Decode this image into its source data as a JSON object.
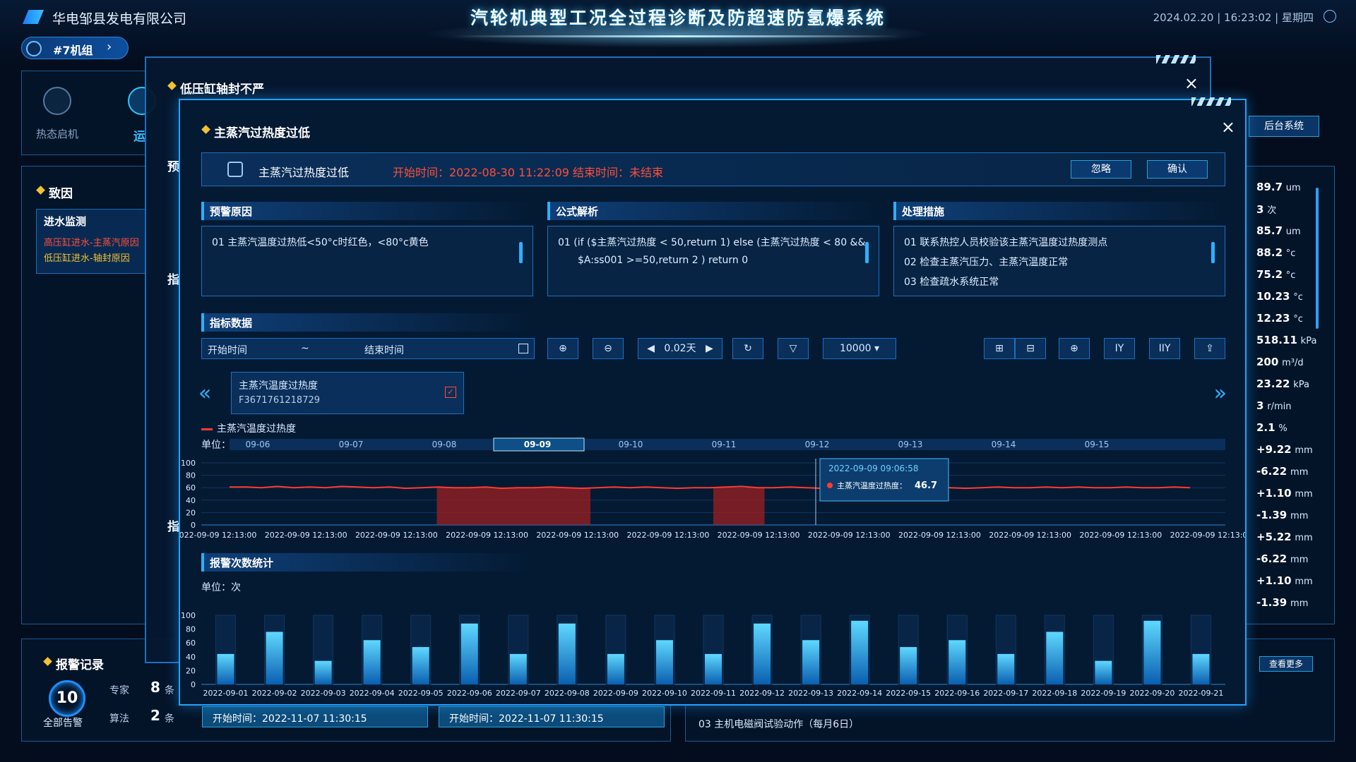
{
  "header": {
    "company": "华电邹县发电有限公司",
    "title": "汽轮机典型工况全过程诊断及防超速防氢爆系统",
    "datetime": "2024.02.20 | 16:23:02 | 星期四",
    "unit": "#7机组"
  },
  "status_steps": {
    "hot_start": "热态启机",
    "run": "运"
  },
  "cause_panel": {
    "title": "致因",
    "section": "进水监测",
    "items": [
      "高压缸进水-主蒸汽原因",
      "低压缸进水-轴封原因"
    ]
  },
  "alarm_records": {
    "title": "报警记录",
    "total": "10",
    "total_label": "全部告警",
    "expert_label": "专家",
    "expert_count": "8",
    "expert_unit": "条",
    "algo_label": "算法",
    "algo_count": "2",
    "algo_unit": "条",
    "start_1": "开始时间：2022-11-07 11:30:15",
    "start_2": "开始时间：2022-11-07 11:30:15",
    "task_03": "03   主机电磁阀试验动作（每月6日）",
    "see_more": "查看更多"
  },
  "right_values": [
    {
      "value": "89.7",
      "unit": "um"
    },
    {
      "value": "3",
      "unit": "次"
    },
    {
      "value": "85.7",
      "unit": "um"
    },
    {
      "value": "88.2",
      "unit": "°c"
    },
    {
      "value": "75.2",
      "unit": "°c"
    },
    {
      "value": "10.23",
      "unit": "°c"
    },
    {
      "value": "12.23",
      "unit": "°c"
    },
    {
      "value": "518.11",
      "unit": "kPa"
    },
    {
      "value": "200",
      "unit": "m³/d"
    },
    {
      "value": "23.22",
      "unit": "kPa"
    },
    {
      "value": "3",
      "unit": "r/min"
    },
    {
      "value": "2.1",
      "unit": "%"
    },
    {
      "value": "+9.22",
      "unit": "mm"
    },
    {
      "value": "-6.22",
      "unit": "mm"
    },
    {
      "value": "+1.10",
      "unit": "mm"
    },
    {
      "value": "-1.39",
      "unit": "mm"
    },
    {
      "value": "+5.22",
      "unit": "mm"
    },
    {
      "value": "-6.22",
      "unit": "mm"
    },
    {
      "value": "+1.10",
      "unit": "mm"
    },
    {
      "value": "-1.39",
      "unit": "mm"
    }
  ],
  "backend_button": "后台系统",
  "modal_outer": {
    "title": "低压缸轴封不严",
    "close": "×",
    "side_1": "预",
    "side_2": "指",
    "side_3": "指"
  },
  "modal": {
    "title": "主蒸汽过热度过低",
    "close": "×",
    "alert_name": "主蒸汽过热度过低",
    "alert_times": "开始时间：2022-08-30 11:22:09   结束时间：未结束",
    "ignore": "忽略",
    "confirm": "确认",
    "reason_title": "预警原因",
    "reason_line": "01   主蒸汽温度过热低<50°c时红色，<80°c黄色",
    "formula_title": "公式解析",
    "formula_line1": "01   (if ($主蒸汽过热度 < 50,return 1) else (主蒸汽过热度 < 80 &&",
    "formula_line2": "$A:ss001 >=50,return 2 )  return 0",
    "measure_title": "处理措施",
    "measures": [
      "01   联系热控人员校验该主蒸汽温度过热度测点",
      "02   检查主蒸汽压力、主蒸汽温度正常",
      "03   检查疏水系统正常"
    ],
    "index_title": "指标数据",
    "start_placeholder": "开始时间",
    "range_sep": "~",
    "end_placeholder": "结束时间",
    "step": "0.02天",
    "limit": "10000",
    "iy": "IY",
    "iiy": "IIY",
    "series_name": "主蒸汽温度过热度",
    "series_code": "F3671761218729",
    "alarm_stat_title": "报警次数统计",
    "unit_chart2": "单位：次"
  },
  "chart_data": [
    {
      "type": "line",
      "legend": "主蒸汽温度过热度",
      "unit_label": "单位：%",
      "ylim": [
        0,
        100
      ],
      "yticks": [
        100,
        80,
        60,
        40,
        20,
        0
      ],
      "timeline_ticks": [
        "09-06",
        "09-07",
        "09-08",
        "09-09",
        "09-10",
        "09-11",
        "09-12",
        "09-13",
        "09-14",
        "09-15"
      ],
      "timeline_selected": "09-09",
      "x_labels": [
        "2022-09-09 12:13:00",
        "2022-09-09 12:13:00",
        "2022-09-09 12:13:00",
        "2022-09-09 12:13:00",
        "2022-09-09 12:13:00",
        "2022-09-09 12:13:00",
        "2022-09-09 12:13:00",
        "2022-09-09 12:13:00",
        "2022-09-09 12:13:00",
        "2022-09-09 12:13:00",
        "2022-09-09 12:13:00",
        "2022-09-09 12:13:00"
      ],
      "values": [
        61,
        61,
        60,
        62,
        60,
        61,
        60,
        62,
        61,
        60,
        61,
        59,
        60,
        61,
        60,
        60,
        61,
        59,
        60,
        60,
        61,
        60,
        59,
        60,
        61,
        60,
        61,
        60,
        59,
        60,
        60,
        61,
        62,
        60,
        60,
        61,
        60,
        59,
        61,
        60,
        60,
        61,
        60,
        60,
        61,
        60,
        59,
        60,
        61,
        60,
        60,
        61,
        60,
        61,
        60,
        60,
        61,
        60,
        60,
        61,
        60
      ],
      "highlight_ranges": [
        [
          0.23,
          0.38
        ],
        [
          0.5,
          0.55
        ]
      ],
      "tooltip": {
        "time": "2022-09-09 09:06:58",
        "label": "主蒸汽温度过热度：",
        "value": "46.7",
        "at": 0.6
      }
    },
    {
      "type": "bar",
      "ylim": [
        0,
        100
      ],
      "yticks": [
        100,
        80,
        60,
        40,
        20,
        0
      ],
      "categories": [
        "2022-09-01",
        "2022-09-02",
        "2022-09-03",
        "2022-09-04",
        "2022-09-05",
        "2022-09-06",
        "2022-09-07",
        "2022-09-08",
        "2022-09-09",
        "2022-09-10",
        "2022-09-11",
        "2022-09-12",
        "2022-09-13",
        "2022-09-14",
        "2022-09-15",
        "2022-09-16",
        "2022-09-17",
        "2022-09-18",
        "2022-09-19",
        "2022-09-20",
        "2022-09-21"
      ],
      "values": [
        44,
        76,
        34,
        64,
        54,
        88,
        44,
        88,
        44,
        64,
        44,
        88,
        64,
        92,
        54,
        64,
        44,
        76,
        34,
        92,
        44
      ]
    }
  ]
}
